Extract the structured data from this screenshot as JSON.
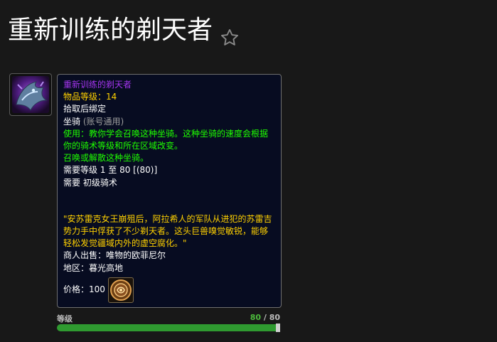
{
  "header": {
    "title": "重新训练的剃天者",
    "favorite_icon": "star-outline-icon"
  },
  "item": {
    "icon": "mount-skyterror-icon",
    "name": "重新训练的剃天者",
    "item_level_label": "物品等级：",
    "item_level": "14",
    "binding": "拾取后绑定",
    "type": "坐骑",
    "type_note": "(账号通用)",
    "use_text": "使用：教你学会召唤这种坐骑。这种坐骑的速度会根据你的骑术等级和所在区域改变。",
    "summon_text": "召唤或解散这种坐骑。",
    "req_level": "需要等级 1 至 80 [(80)]",
    "req_skill": "需要 初级骑术",
    "flavor": "\"安苏雷克女王崩殂后，阿拉希人的军队从进犯的苏雷吉势力手中俘获了不少剃天者。这头巨兽嗅觉敏锐，能够轻松发觉疆域内外的虚空腐化。\"",
    "vendor": "商人出售：唯物的欧菲尼尔",
    "zone": "地区：暮光高地",
    "price_label": "价格：",
    "price_value": "100",
    "currency_icon": "bronze-currency-icon"
  },
  "progress": {
    "label": "等级",
    "current": "80",
    "separator": " / ",
    "max": "80",
    "fraction": 1.0
  },
  "colors": {
    "epic": "#a335ee",
    "gold": "#ffd100",
    "green": "#1eff00",
    "progress": "#2f9a30"
  }
}
